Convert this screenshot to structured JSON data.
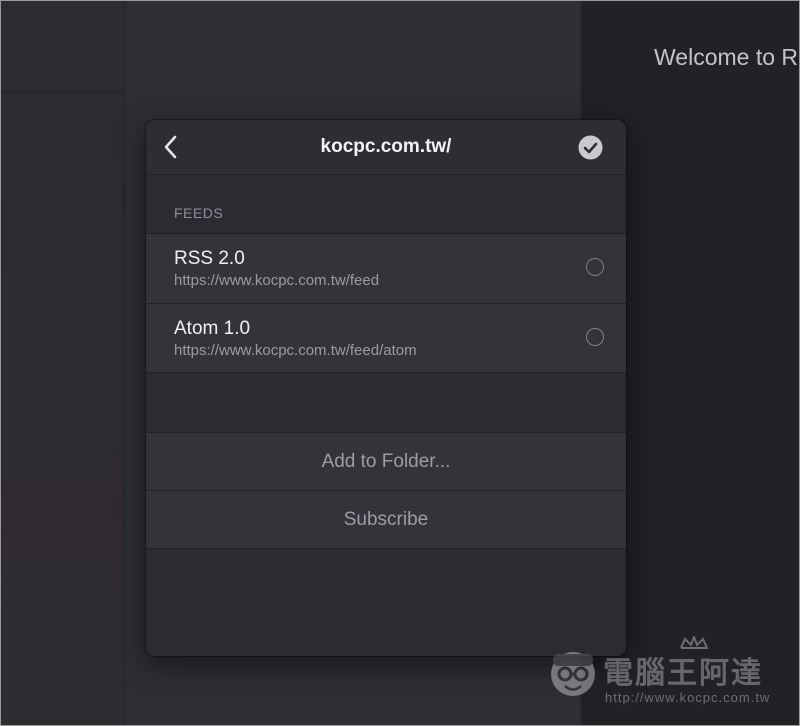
{
  "background": {
    "welcome_text": "Welcome to R"
  },
  "popover": {
    "title": "kocpc.com.tw/",
    "section_label": "FEEDS",
    "feeds": [
      {
        "name": "RSS 2.0",
        "url": "https://www.kocpc.com.tw/feed",
        "selected": false
      },
      {
        "name": "Atom 1.0",
        "url": "https://www.kocpc.com.tw/feed/atom",
        "selected": false
      }
    ],
    "add_to_folder_label": "Add to Folder...",
    "subscribe_label": "Subscribe"
  },
  "watermark": {
    "text": "電腦王阿達",
    "url": "http://www.kocpc.com.tw"
  },
  "colors": {
    "panel_bg": "#2a2c32",
    "row_bg": "#32343a",
    "title_text": "#f2f2f3",
    "muted_text": "#9c9ea3"
  }
}
